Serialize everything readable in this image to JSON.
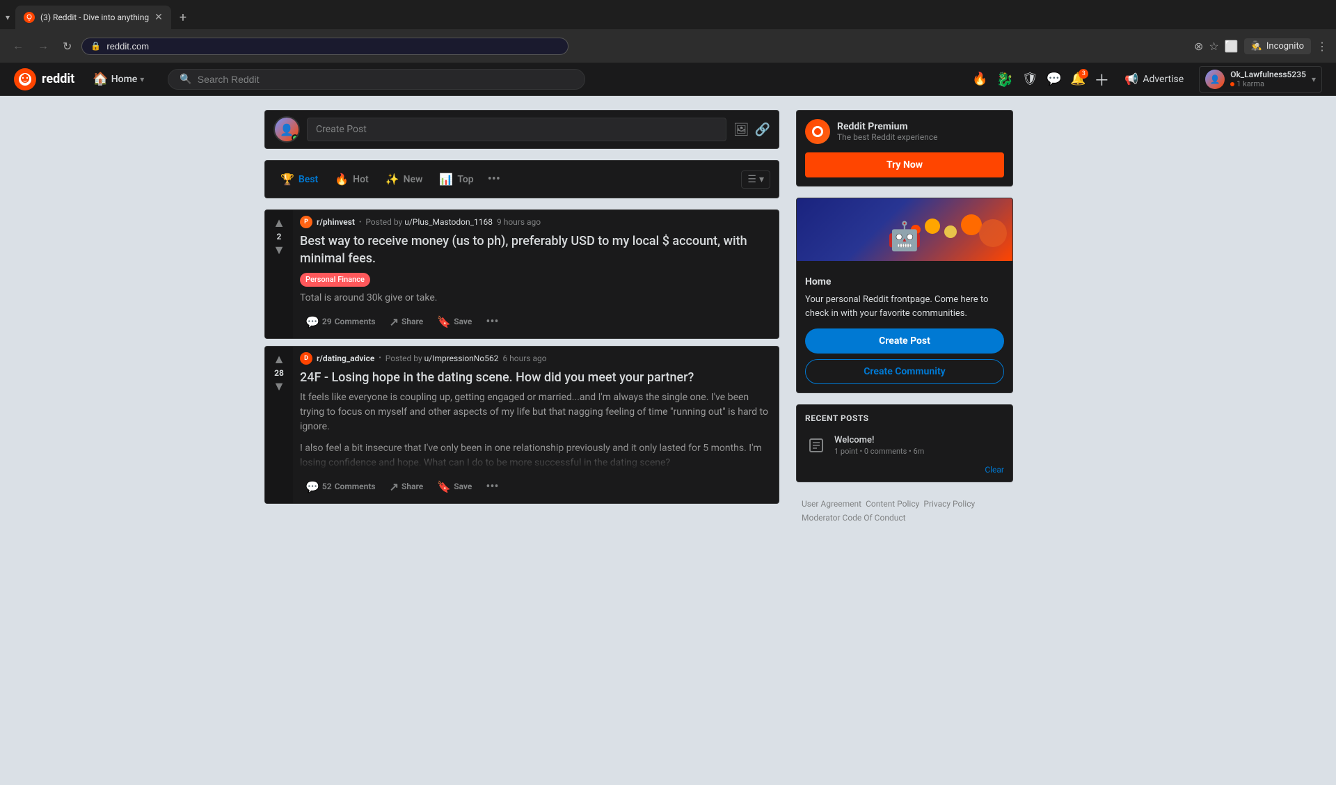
{
  "browser": {
    "tab_count": "(3)",
    "tab_title": "Reddit - Dive into anything",
    "url": "reddit.com",
    "incognito_label": "Incognito"
  },
  "header": {
    "logo_text": "reddit",
    "home_label": "Home",
    "search_placeholder": "Search Reddit",
    "advertise_label": "Advertise",
    "notification_count": "3",
    "username": "Ok_Lawfulness5235",
    "karma": "1 karma"
  },
  "create_post_bar": {
    "placeholder": "Create Post"
  },
  "sort_bar": {
    "best": "Best",
    "hot": "Hot",
    "new": "New",
    "top": "Top",
    "more": "•••"
  },
  "posts": [
    {
      "id": 1,
      "subreddit": "r/phinvest",
      "subreddit_type": "phinvest",
      "posted_by_label": "Posted by",
      "author": "u/Plus_Mastodon_1168",
      "time": "9 hours ago",
      "vote_count": "2",
      "title": "Best way to receive money (us to ph), preferably USD to my local $ account, with minimal fees.",
      "flair": "Personal Finance",
      "body": "",
      "excerpt": "Total is around 30k give or take.",
      "comments_count": "29",
      "comments_label": "Comments",
      "share_label": "Share",
      "save_label": "Save"
    },
    {
      "id": 2,
      "subreddit": "r/dating_advice",
      "subreddit_type": "dating",
      "posted_by_label": "Posted by",
      "author": "u/ImpressionNo562",
      "time": "6 hours ago",
      "vote_count": "28",
      "title": "24F - Losing hope in the dating scene. How did you meet your partner?",
      "flair": "",
      "excerpt": "It feels like everyone is coupling up, getting engaged or married...and I'm always the single one. I've been trying to focus on myself and other aspects of my life but that nagging feeling of time \"running out\" is hard to ignore.",
      "excerpt2": "I also feel a bit insecure that I've only been in one relationship previously and it only lasted for 5 months. I'm losing confidence and hope. What can I do to be more successful in the dating scene?",
      "comments_count": "52",
      "comments_label": "Comments",
      "share_label": "Share",
      "save_label": "Save"
    }
  ],
  "sidebar": {
    "premium": {
      "title": "Reddit Premium",
      "subtitle": "The best Reddit experience",
      "try_now": "Try Now"
    },
    "home": {
      "title": "Home",
      "description": "Your personal Reddit frontpage. Come here to check in with your favorite communities.",
      "create_post": "Create Post",
      "create_community": "Create Community"
    },
    "recent_posts": {
      "section_title": "RECENT POSTS",
      "item_title": "Welcome!",
      "item_meta": "1 point • 0 comments • 6m",
      "clear": "Clear"
    },
    "footer_links": [
      "User Agreement",
      "Content Policy",
      "Privacy Policy",
      "Moderator Code Of Conduct"
    ]
  }
}
